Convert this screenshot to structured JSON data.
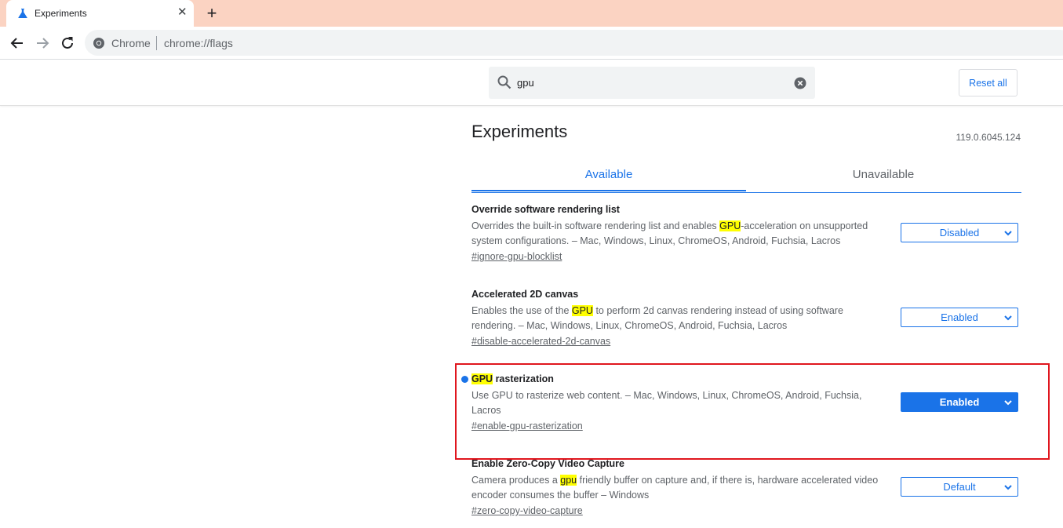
{
  "browser": {
    "tab_title": "Experiments",
    "omnibox_chip": "Chrome",
    "url": "chrome://flags"
  },
  "header": {
    "search_value": "gpu",
    "reset_label": "Reset all"
  },
  "page": {
    "title": "Experiments",
    "version": "119.0.6045.124",
    "tabs": [
      "Available",
      "Unavailable"
    ]
  },
  "flags": [
    {
      "name": "Override software rendering list",
      "desc_pre": "Overrides the built-in software rendering list and enables ",
      "desc_hl": "GPU",
      "desc_post": "-acceleration on unsupported system configurations. – Mac, Windows, Linux, ChromeOS, Android, Fuchsia, Lacros",
      "link": "#ignore-gpu-blocklist",
      "state": "Disabled"
    },
    {
      "name": "Accelerated 2D canvas",
      "desc_pre": "Enables the use of the ",
      "desc_hl": "GPU",
      "desc_post": " to perform 2d canvas rendering instead of using software rendering. – Mac, Windows, Linux, ChromeOS, Android, Fuchsia, Lacros",
      "link": "#disable-accelerated-2d-canvas",
      "state": "Enabled"
    },
    {
      "name_hl": "GPU",
      "name_post": " rasterization",
      "desc": "Use GPU to rasterize web content. – Mac, Windows, Linux, ChromeOS, Android, Fuchsia, Lacros",
      "link": "#enable-gpu-rasterization",
      "state": "Enabled"
    },
    {
      "name": "Enable Zero-Copy Video Capture",
      "desc_pre": "Camera produces a ",
      "desc_hl": "gpu",
      "desc_post": " friendly buffer on capture and, if there is, hardware accelerated video encoder consumes the buffer – Windows",
      "link": "#zero-copy-video-capture",
      "state": "Default"
    }
  ],
  "colors": {
    "accent": "#1a73e8",
    "highlight": "#ffff00",
    "tabstrip": "#fbd3c2",
    "annotation_box": "#e0161e"
  }
}
